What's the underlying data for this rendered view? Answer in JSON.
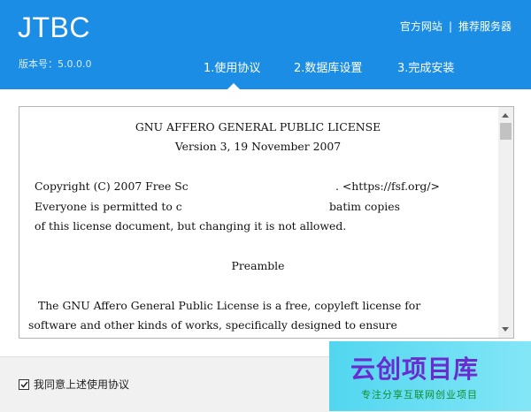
{
  "header": {
    "app_title": "JTBC",
    "version": "版本号：5.0.0.0",
    "links": [
      "官方网站",
      "|",
      "推荐服务器"
    ],
    "steps": [
      {
        "label": "1.使用协议",
        "active": true
      },
      {
        "label": "2.数据库设置",
        "active": false
      },
      {
        "label": "3.完成安装",
        "active": false
      }
    ]
  },
  "license": {
    "lines": [
      "GNU AFFERO GENERAL PUBLIC LICENSE",
      "Version 3, 19 November 2007",
      "Copyright (C) 2007 Free Sc",
      ". <https://fsf.org/>",
      "Everyone is permitted to c",
      "batim copies",
      "of this license document, but changing it is not allowed.",
      "Preamble",
      " The GNU Affero General Public License is a free, copyleft license for",
      "software and other kinds of works, specifically designed to ensure"
    ]
  },
  "footer": {
    "agree_label": "我同意上述使用协议",
    "agree_checked": true
  },
  "watermark": {
    "title": "云创项目库",
    "subtitle": "专注分享互联网创业项目"
  },
  "colors": {
    "header_bg": "#1c8de4",
    "footer_bg": "#f1f1f1",
    "watermark_title": "#6a2bd1"
  }
}
